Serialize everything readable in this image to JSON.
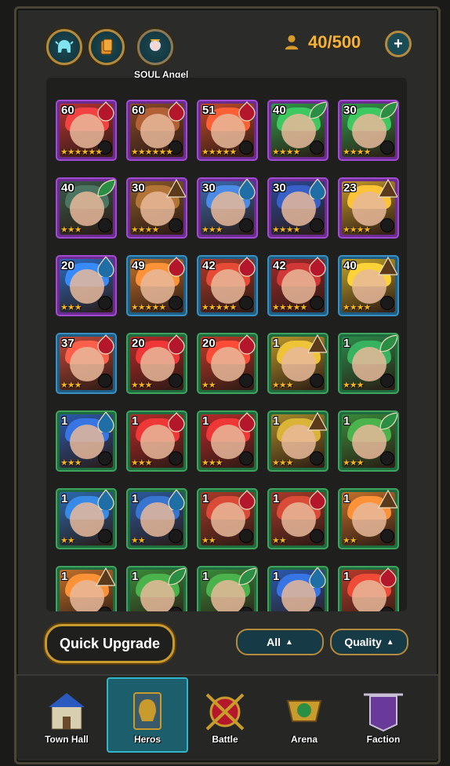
{
  "header": {
    "avatar_name": "SOUL Angel",
    "hero_count": "40/500",
    "plus_label": "+"
  },
  "heroes": [
    {
      "level": "60",
      "stars": "★★★★★★",
      "frame": "purple",
      "faction": "fire",
      "tint": "#b33"
    },
    {
      "level": "60",
      "stars": "★★★★★★",
      "frame": "purple",
      "faction": "fire",
      "tint": "#8a4a2a"
    },
    {
      "level": "51",
      "stars": "★★★★★",
      "frame": "purple",
      "faction": "fire",
      "tint": "#c24a2a"
    },
    {
      "level": "40",
      "stars": "★★★★",
      "frame": "purple",
      "faction": "nature",
      "tint": "#2f9a4a"
    },
    {
      "level": "30",
      "stars": "★★★★",
      "frame": "purple",
      "faction": "nature",
      "tint": "#2f9a4a"
    },
    {
      "level": "40",
      "stars": "★★★",
      "frame": "purple",
      "faction": "nature",
      "tint": "#3a5a4a"
    },
    {
      "level": "30",
      "stars": "★★★★",
      "frame": "purple",
      "faction": "earth",
      "tint": "#8a5a2a"
    },
    {
      "level": "30",
      "stars": "★★★",
      "frame": "purple",
      "faction": "water",
      "tint": "#3a6ab0"
    },
    {
      "level": "30",
      "stars": "★★★★",
      "frame": "purple",
      "faction": "water",
      "tint": "#2a4a9a"
    },
    {
      "level": "23",
      "stars": "★★★★",
      "frame": "purple",
      "faction": "earth",
      "tint": "#c2962a"
    },
    {
      "level": "20",
      "stars": "★★★",
      "frame": "purple",
      "faction": "water",
      "tint": "#2a6ac0"
    },
    {
      "level": "49",
      "stars": "★★★★★",
      "frame": "blue",
      "faction": "fire",
      "tint": "#c2702a"
    },
    {
      "level": "42",
      "stars": "★★★★★",
      "frame": "blue",
      "faction": "fire",
      "tint": "#b03a2a"
    },
    {
      "level": "42",
      "stars": "★★★★★",
      "frame": "blue",
      "faction": "fire",
      "tint": "#a02a2a"
    },
    {
      "level": "40",
      "stars": "★★★★",
      "frame": "blue",
      "faction": "earth",
      "tint": "#c2a22a"
    },
    {
      "level": "37",
      "stars": "★★★",
      "frame": "blue",
      "faction": "fire",
      "tint": "#c24a3a"
    },
    {
      "level": "20",
      "stars": "★★★",
      "frame": "green",
      "faction": "fire",
      "tint": "#b82a2a"
    },
    {
      "level": "20",
      "stars": "★★",
      "frame": "green",
      "faction": "fire",
      "tint": "#c23a2a"
    },
    {
      "level": "1",
      "stars": "★★★",
      "frame": "green",
      "faction": "earth",
      "tint": "#b8962a"
    },
    {
      "level": "1",
      "stars": "★★★",
      "frame": "green",
      "faction": "nature",
      "tint": "#2a8a4a"
    },
    {
      "level": "1",
      "stars": "★★★",
      "frame": "green",
      "faction": "water",
      "tint": "#2a5ab0"
    },
    {
      "level": "1",
      "stars": "★★★",
      "frame": "green",
      "faction": "fire",
      "tint": "#b82a2a"
    },
    {
      "level": "1",
      "stars": "★★★",
      "frame": "green",
      "faction": "fire",
      "tint": "#b82a2a"
    },
    {
      "level": "1",
      "stars": "★★★",
      "frame": "green",
      "faction": "earth",
      "tint": "#a88a2a"
    },
    {
      "level": "1",
      "stars": "★★★",
      "frame": "green",
      "faction": "nature",
      "tint": "#3a8a3a"
    },
    {
      "level": "1",
      "stars": "★★",
      "frame": "green",
      "faction": "water",
      "tint": "#2a6ab0"
    },
    {
      "level": "1",
      "stars": "★★",
      "frame": "green",
      "faction": "water",
      "tint": "#2a5aa0"
    },
    {
      "level": "1",
      "stars": "★★",
      "frame": "green",
      "faction": "fire",
      "tint": "#a83a2a"
    },
    {
      "level": "1",
      "stars": "★★",
      "frame": "green",
      "faction": "fire",
      "tint": "#a83a2a"
    },
    {
      "level": "1",
      "stars": "★★",
      "frame": "green",
      "faction": "earth",
      "tint": "#c2702a"
    },
    {
      "level": "1",
      "stars": "",
      "frame": "green",
      "faction": "earth",
      "tint": "#c2702a"
    },
    {
      "level": "1",
      "stars": "",
      "frame": "green",
      "faction": "nature",
      "tint": "#3a8a3a"
    },
    {
      "level": "1",
      "stars": "",
      "frame": "green",
      "faction": "nature",
      "tint": "#3a8a3a"
    },
    {
      "level": "1",
      "stars": "",
      "frame": "green",
      "faction": "water",
      "tint": "#2a5ab0"
    },
    {
      "level": "1",
      "stars": "",
      "frame": "green",
      "faction": "fire",
      "tint": "#b83a2a"
    }
  ],
  "controls": {
    "quick_upgrade": "Quick Upgrade",
    "filter_all": "All",
    "filter_quality": "Quality",
    "arrow_up": "▲"
  },
  "nav": [
    {
      "label": "Town Hall",
      "icon": "town-hall-icon",
      "active": false
    },
    {
      "label": "Heros",
      "icon": "heros-icon",
      "active": true
    },
    {
      "label": "Battle",
      "icon": "battle-icon",
      "active": false
    },
    {
      "label": "Arena",
      "icon": "arena-icon",
      "active": false
    },
    {
      "label": "Faction",
      "icon": "faction-icon",
      "active": false
    }
  ],
  "faction_colors": {
    "fire": "#b4172c",
    "nature": "#2a8f44",
    "water": "#1f6fa6",
    "earth": "#5a3a1a"
  }
}
